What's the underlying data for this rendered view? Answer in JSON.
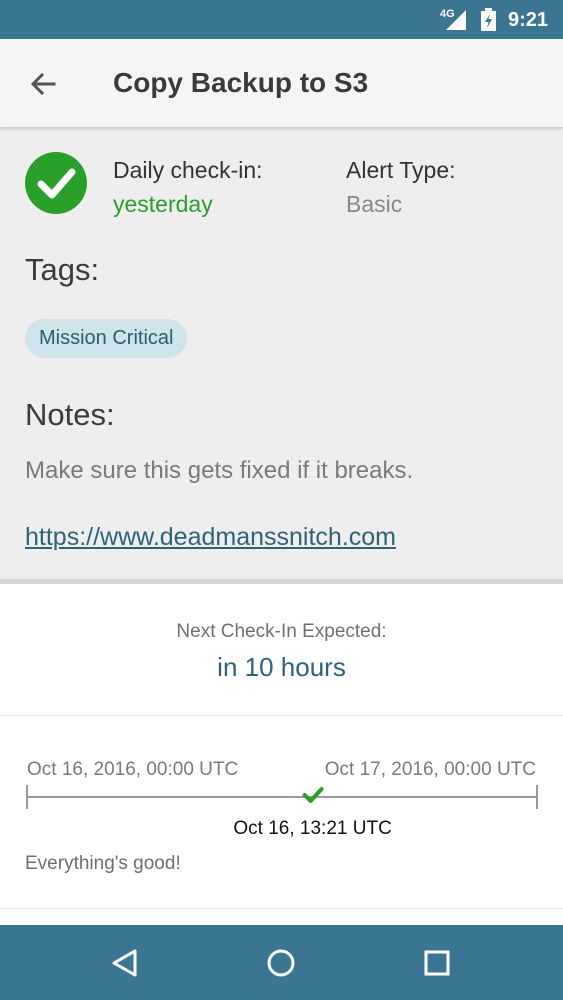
{
  "status_bar": {
    "network": "4G",
    "time": "9:21"
  },
  "app_bar": {
    "title": "Copy Backup to S3"
  },
  "details": {
    "daily_label": "Daily check-in:",
    "daily_value": "yesterday",
    "alert_label": "Alert Type:",
    "alert_value": "Basic",
    "tags_title": "Tags:",
    "tags": [
      "Mission Critical"
    ],
    "notes_title": "Notes:",
    "notes_text": "Make sure this gets fixed if it breaks.",
    "notes_link": "https://www.deadmanssnitch.com"
  },
  "next_checkin": {
    "label": "Next Check-In Expected:",
    "value": "in 10 hours"
  },
  "timeline": {
    "start": "Oct 16, 2016, 00:00 UTC",
    "end": "Oct 17, 2016, 00:00 UTC",
    "current": "Oct 16, 13:21 UTC",
    "progress": 0.56
  },
  "status_message": "Everything's good!",
  "colors": {
    "primary": "#3a7592",
    "success": "#2aa02a",
    "link": "#2d6378",
    "tag_bg": "#cfe3ea"
  },
  "icons": {
    "back": "arrow-left-icon",
    "status": "check-circle-icon",
    "nav_back": "triangle-back-icon",
    "nav_home": "circle-home-icon",
    "nav_recents": "square-recents-icon"
  }
}
